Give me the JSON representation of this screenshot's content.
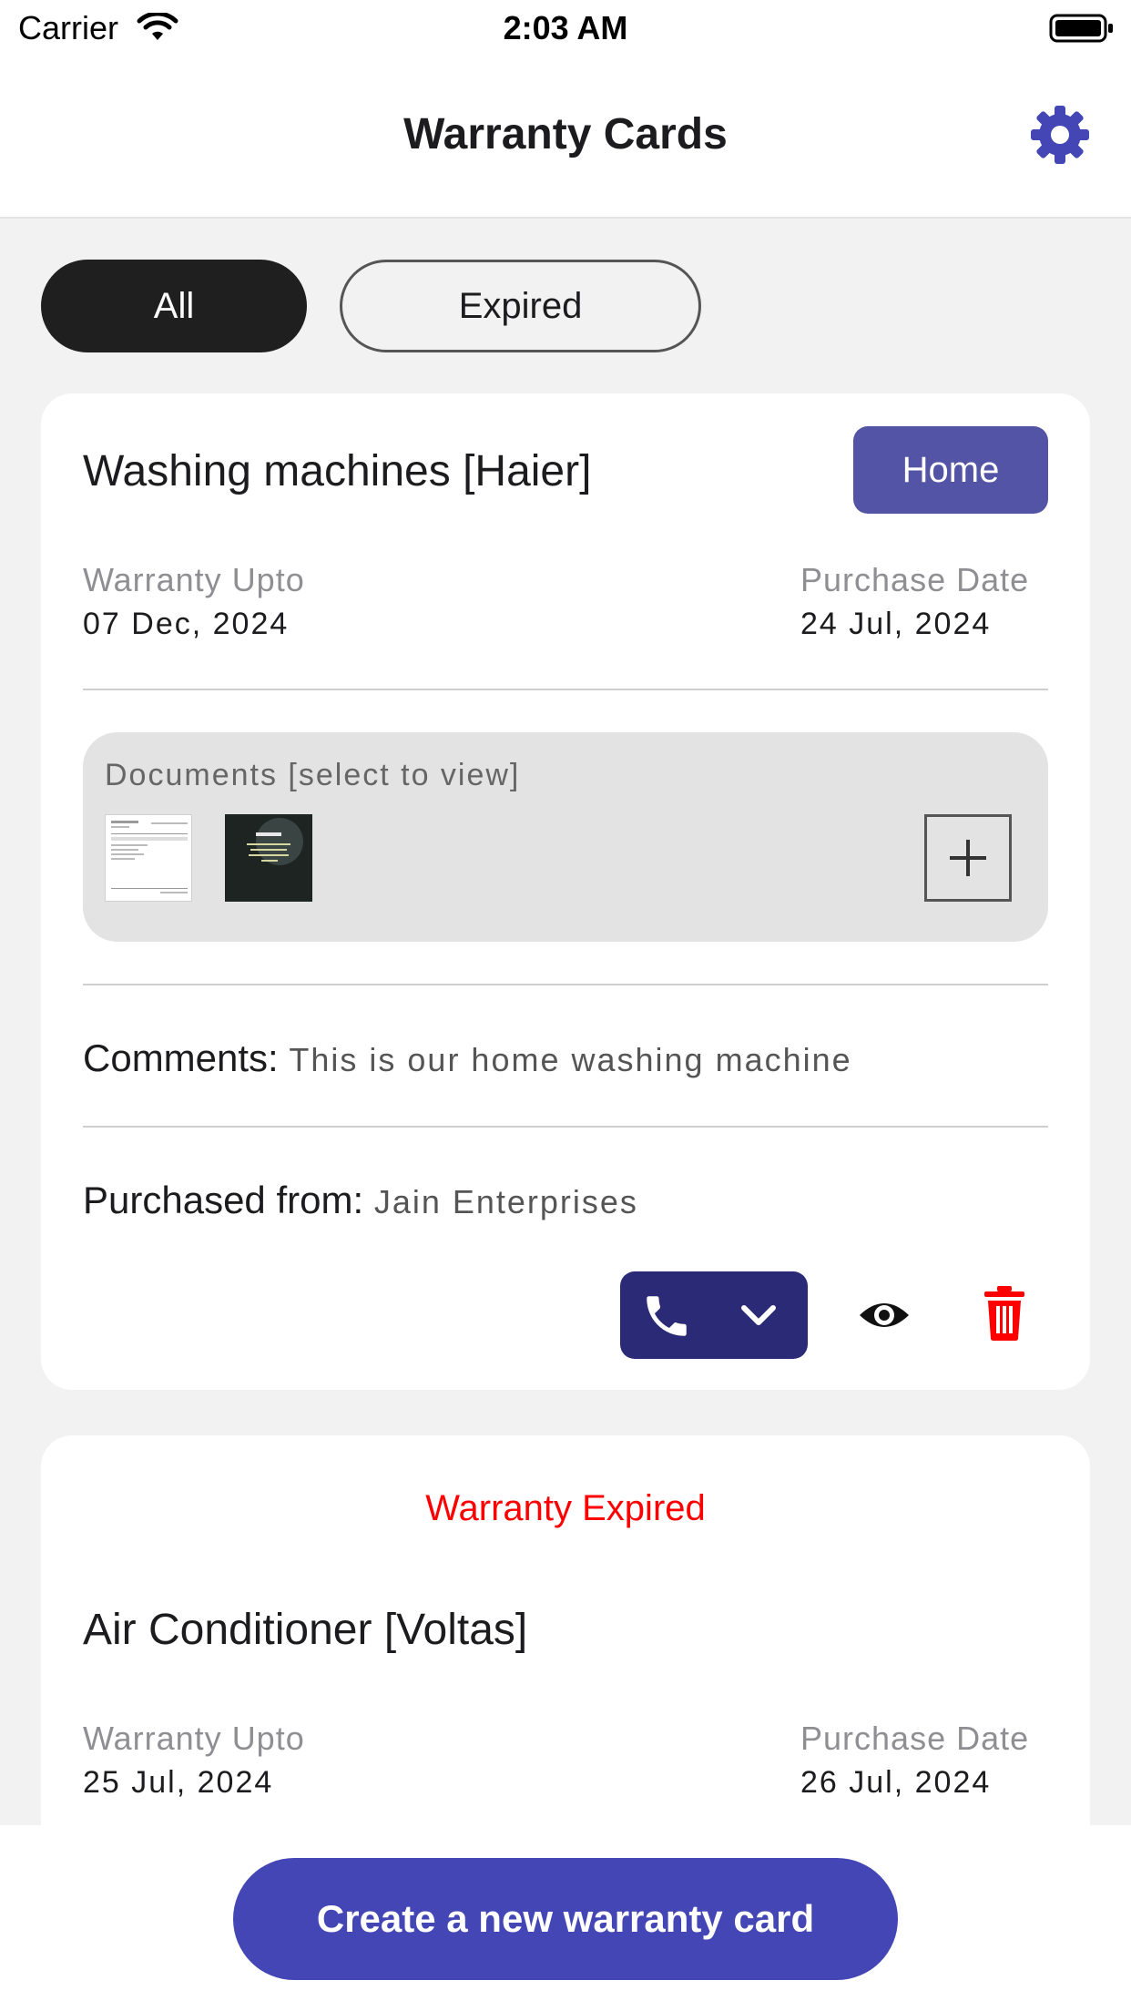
{
  "status_bar": {
    "carrier": "Carrier",
    "time": "2:03 AM"
  },
  "nav": {
    "title": "Warranty Cards",
    "settings_icon": "gear-icon"
  },
  "tabs": [
    {
      "label": "All",
      "selected": true
    },
    {
      "label": "Expired",
      "selected": false
    }
  ],
  "cards": [
    {
      "title": "Washing machines [Haier]",
      "tag": "Home",
      "warranty_label": "Warranty Upto",
      "warranty_value": "07 Dec, 2024",
      "purchase_label": "Purchase Date",
      "purchase_value": "24 Jul, 2024",
      "documents_label": "Documents [select to view]",
      "documents_count": 2,
      "comments_label": "Comments:",
      "comments_value": "This is our home washing machine",
      "purchased_from_label": "Purchased from:",
      "purchased_from_value": "Jain Enterprises"
    },
    {
      "expired_notice": "Warranty Expired",
      "title": "Air Conditioner [Voltas]",
      "warranty_label": "Warranty Upto",
      "warranty_value": "25 Jul, 2024",
      "purchase_label": "Purchase Date",
      "purchase_value": "26 Jul, 2024"
    }
  ],
  "footer": {
    "create_label": "Create a new warranty card"
  },
  "colors": {
    "accent": "#4346b4",
    "tag": "#5354a6",
    "call_button": "#2a2a76",
    "danger": "#ff0000",
    "tab_selected": "#1f1f1f"
  }
}
